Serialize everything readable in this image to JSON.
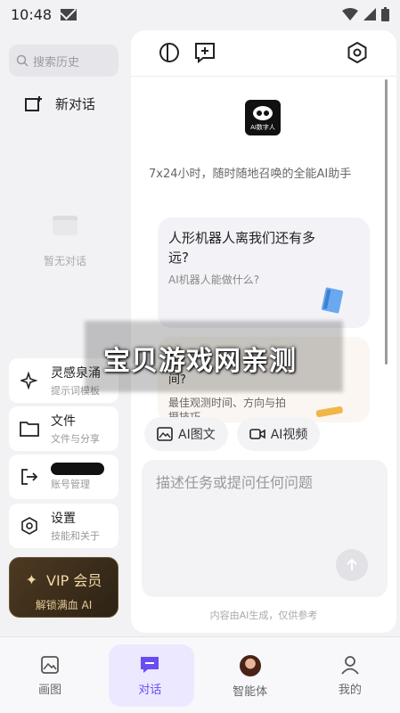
{
  "status_bar": {
    "time": "10:48"
  },
  "sidebar": {
    "search_placeholder": "搜索历史",
    "new_chat_label": "新对话",
    "empty_text": "暂无对话",
    "menu": [
      {
        "title": "灵感泉涌",
        "subtitle": "提示词模板",
        "icon": "sparkle-icon"
      },
      {
        "title": "文件",
        "subtitle": "文件与分享",
        "icon": "folder-icon"
      },
      {
        "title": "",
        "subtitle": "账号管理",
        "icon": "logout-icon"
      },
      {
        "title": "设置",
        "subtitle": "技能和关于",
        "icon": "settings-icon"
      }
    ],
    "vip": {
      "title": "VIP 会员",
      "subtitle": "解锁满血 AI"
    }
  },
  "main": {
    "logo_text": "AI数字人",
    "tagline": "7x24小时，随时随地召唤的全能AI助手",
    "suggestions": [
      {
        "question": "人形机器人离我们还有多远?",
        "sub": "AI机器人能做什么?"
      },
      {
        "question": "间?",
        "sub": "最佳观测时间、方向与拍摄技巧"
      }
    ],
    "chips": [
      {
        "label": "AI图文",
        "icon": "image-icon"
      },
      {
        "label": "AI视频",
        "icon": "video-icon"
      }
    ],
    "input_placeholder": "描述任务或提问任何问题",
    "disclaimer": "内容由AI生成，仅供参考"
  },
  "watermark": "宝贝游戏网亲测",
  "bottom_nav": [
    {
      "label": "画图",
      "icon": "picture-icon",
      "active": false
    },
    {
      "label": "对话",
      "icon": "chat-icon",
      "active": true
    },
    {
      "label": "智能体",
      "icon": "agent-avatar-icon",
      "active": false
    },
    {
      "label": "我的",
      "icon": "profile-icon",
      "active": false
    }
  ],
  "colors": {
    "accent": "#6b4cf2",
    "vip_gold": "#f3d7a6"
  }
}
